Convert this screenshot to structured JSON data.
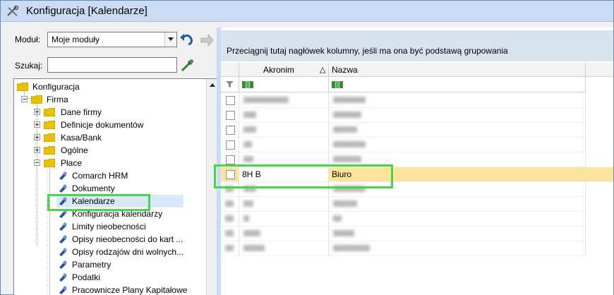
{
  "window": {
    "title": "Konfiguracja [Kalendarze]"
  },
  "filters": {
    "module_label": "Moduł:",
    "module_value": "Moje moduły",
    "search_label": "Szukaj:",
    "search_value": ""
  },
  "tree": {
    "root": "Konfiguracja",
    "firma": "Firma",
    "firma_children": [
      "Dane firmy",
      "Definicje dokumentów",
      "Kasa/Bank",
      "Ogólne",
      "Płace"
    ],
    "place_children": [
      "Comarch HRM",
      "Dokumenty",
      "Kalendarze",
      "Konfiguracja kalendarzy",
      "Limity nieobecności",
      "Opisy nieobecności do kart ...",
      "Opisy rodzajów dni wolnych...",
      "Parametry",
      "Podatki",
      "Pracownicze Plany Kapitałowe"
    ],
    "selected": "Kalendarze"
  },
  "grid": {
    "group_hint": "Przeciągnij tutaj nagłówek kolumny, jeśli ma ona być podstawą grupowania",
    "columns": [
      "Akronim",
      "Nazwa"
    ],
    "sort_indicator": "△",
    "highlighted_row": {
      "akronim": "8H B",
      "nazwa": "Biuro"
    }
  },
  "colors": {
    "highlight": "#fde49b",
    "focus_frame": "#45d64a",
    "selection": "#d9e8fa"
  }
}
